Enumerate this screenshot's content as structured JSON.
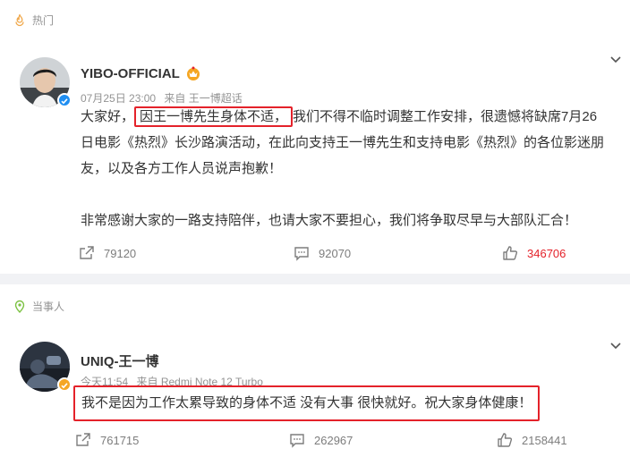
{
  "hot_section": {
    "label": "热门"
  },
  "post1": {
    "username": "YIBO-OFFICIAL",
    "time": "07月25日 23:00",
    "source": "来自 王一博超话",
    "text_before": "大家好，",
    "text_highlight": "因王一博先生身体不适，",
    "text_after": "我们不得不临时调整工作安排，很遗憾将缺席7月26日电影《热烈》长沙路演活动，在此向支持王一博先生和支持电影《热烈》的各位影迷朋友，以及各方工作人员说声抱歉！",
    "text_para2": "非常感谢大家的一路支持陪伴，也请大家不要担心，我们将争取尽早与大部队汇合！",
    "reposts": "79120",
    "comments": "92070",
    "likes": "346706"
  },
  "party_section": {
    "label": "当事人"
  },
  "post2": {
    "username": "UNIQ-王一博",
    "time": "今天11:54",
    "source": "来自 Redmi Note 12 Turbo",
    "text": "我不是因为工作太累导致的身体不适 没有大事 很快就好。祝大家身体健康！",
    "reposts": "761715",
    "comments": "262967",
    "likes": "2158441"
  },
  "colors": {
    "accent": "#e4222a",
    "verified": "#1f8ef1",
    "gold": "#f5a623",
    "meta": "#939393"
  },
  "icons": [
    "hot-icon",
    "location-pin-icon",
    "chevron-down-icon",
    "verified-icon",
    "repost-icon",
    "comment-icon",
    "like-icon"
  ]
}
